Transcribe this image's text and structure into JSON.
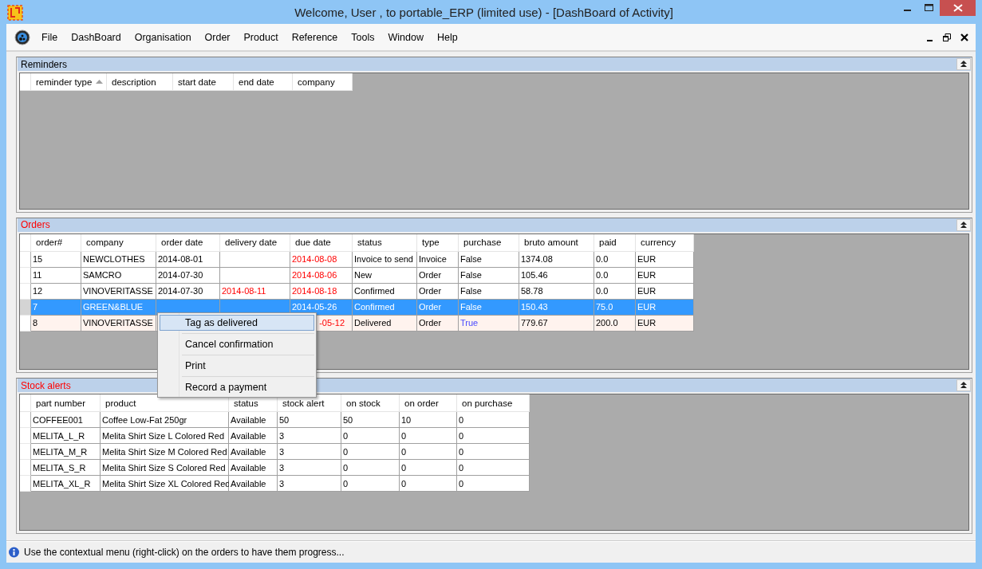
{
  "window": {
    "title": "Welcome, User , to portable_ERP (limited use) - [DashBoard of Activity]"
  },
  "menu": [
    "File",
    "DashBoard",
    "Organisation",
    "Order",
    "Product",
    "Reference",
    "Tools",
    "Window",
    "Help"
  ],
  "panels": [
    {
      "title": "Reminders",
      "alert": false,
      "columns": [
        {
          "label": "reminder type",
          "sorted": true
        },
        {
          "label": "description",
          "sorted": false
        },
        {
          "label": "start date",
          "sorted": false
        },
        {
          "label": "end date",
          "sorted": false
        },
        {
          "label": "company",
          "sorted": false
        }
      ]
    },
    {
      "title": "Orders",
      "alert": true,
      "columns": [
        {
          "label": "order#",
          "sorted": false
        },
        {
          "label": "company",
          "sorted": false
        },
        {
          "label": "order date",
          "sorted": false
        },
        {
          "label": "delivery date",
          "sorted": false
        },
        {
          "label": "due date",
          "sorted": false
        },
        {
          "label": "status",
          "sorted": false
        },
        {
          "label": "type",
          "sorted": false
        },
        {
          "label": "purchase",
          "sorted": false
        },
        {
          "label": "bruto amount",
          "sorted": false
        },
        {
          "label": "paid",
          "sorted": false
        },
        {
          "label": "currency",
          "sorted": false
        }
      ],
      "rows": [
        {
          "selected": false,
          "tinted": false,
          "cells": [
            "15",
            "NEWCLOTHES",
            "2014-08-01",
            null,
            {
              "text": "2014-08-08",
              "alert": true
            },
            "Invoice to send",
            "Invoice",
            "False",
            "1374.08",
            "0.0",
            "EUR"
          ]
        },
        {
          "selected": false,
          "tinted": false,
          "cells": [
            "11",
            "SAMCRO",
            "2014-07-30",
            null,
            {
              "text": "2014-08-06",
              "alert": true
            },
            "New",
            "Order",
            "False",
            "105.46",
            "0.0",
            "EUR"
          ]
        },
        {
          "selected": false,
          "tinted": false,
          "cells": [
            "12",
            "VINOVERITASSE",
            "2014-07-30",
            {
              "text": "2014-08-11",
              "alert": true
            },
            {
              "text": "2014-08-18",
              "alert": true
            },
            "Confirmed",
            "Order",
            "False",
            "58.78",
            "0.0",
            "EUR"
          ]
        },
        {
          "selected": true,
          "tinted": false,
          "cells": [
            "7",
            "GREEN&BLUE",
            null,
            null,
            "2014-05-26",
            "Confirmed",
            "Order",
            "False",
            "150.43",
            "75.0",
            "EUR"
          ]
        },
        {
          "selected": false,
          "tinted": true,
          "cells": [
            "8",
            "VINOVERITASSE",
            null,
            null,
            {
              "text": "-05-12",
              "alert": true,
              "cut": true
            },
            "Delivered",
            "Order",
            {
              "text": "True",
              "highlight": true
            },
            "779.67",
            "200.0",
            "EUR"
          ]
        }
      ]
    },
    {
      "title": "Stock alerts",
      "alert": true,
      "columns": [
        {
          "label": "part number",
          "sorted": false
        },
        {
          "label": "product",
          "sorted": false
        },
        {
          "label": "status",
          "sorted": false
        },
        {
          "label": "stock alert",
          "sorted": false
        },
        {
          "label": "on stock",
          "sorted": false
        },
        {
          "label": "on order",
          "sorted": false
        },
        {
          "label": "on purchase",
          "sorted": false
        }
      ],
      "rows": [
        {
          "selected": false,
          "tinted": false,
          "cells": [
            "COFFEE001",
            "Coffee Low-Fat 250gr",
            "Available",
            "50",
            "50",
            "10",
            "0"
          ]
        },
        {
          "selected": false,
          "tinted": false,
          "cells": [
            "MELITA_L_R",
            "Melita Shirt Size L Colored Red",
            "Available",
            "3",
            "0",
            "0",
            "0"
          ]
        },
        {
          "selected": false,
          "tinted": false,
          "cells": [
            "MELITA_M_R",
            "Melita Shirt Size M Colored Red",
            "Available",
            "3",
            "0",
            "0",
            "0"
          ]
        },
        {
          "selected": false,
          "tinted": false,
          "cells": [
            "MELITA_S_R",
            "Melita Shirt Size S Colored Red",
            "Available",
            "3",
            "0",
            "0",
            "0"
          ]
        },
        {
          "selected": false,
          "tinted": false,
          "cells": [
            "MELITA_XL_R",
            "Melita Shirt Size XL Colored Red",
            "Available",
            "3",
            "0",
            "0",
            "0"
          ]
        }
      ]
    }
  ],
  "context_menu": [
    {
      "label": "Tag as delivered",
      "selected": true
    },
    {
      "label": "Cancel confirmation",
      "selected": false
    },
    {
      "label": "Print",
      "selected": false
    },
    {
      "label": "Record a payment",
      "selected": false
    }
  ],
  "status_bar": "Use the contextual menu (right-click) on the orders to have them progress..."
}
